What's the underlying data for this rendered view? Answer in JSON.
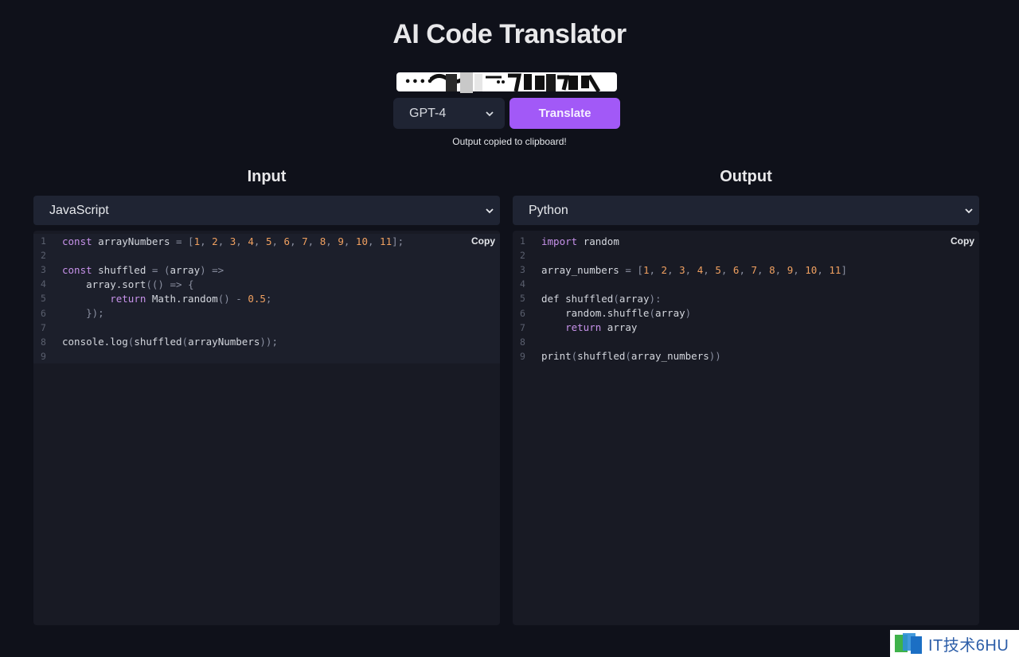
{
  "app": {
    "title": "AI Code Translator"
  },
  "api_key": {
    "value": "••••"
  },
  "model_select": {
    "selected": "GPT-4"
  },
  "translate_button": {
    "label": "Translate"
  },
  "status": {
    "message": "Output copied to clipboard!"
  },
  "input_panel": {
    "heading": "Input",
    "language": "JavaScript",
    "copy_label": "Copy",
    "lines": [
      [
        [
          "const ",
          "kw"
        ],
        [
          "arrayNumbers ",
          "id"
        ],
        [
          "= [",
          "op"
        ],
        [
          "1",
          "num"
        ],
        [
          ", ",
          "op"
        ],
        [
          "2",
          "num"
        ],
        [
          ", ",
          "op"
        ],
        [
          "3",
          "num"
        ],
        [
          ", ",
          "op"
        ],
        [
          "4",
          "num"
        ],
        [
          ", ",
          "op"
        ],
        [
          "5",
          "num"
        ],
        [
          ", ",
          "op"
        ],
        [
          "6",
          "num"
        ],
        [
          ", ",
          "op"
        ],
        [
          "7",
          "num"
        ],
        [
          ", ",
          "op"
        ],
        [
          "8",
          "num"
        ],
        [
          ", ",
          "op"
        ],
        [
          "9",
          "num"
        ],
        [
          ", ",
          "op"
        ],
        [
          "10",
          "num"
        ],
        [
          ", ",
          "op"
        ],
        [
          "11",
          "num"
        ],
        [
          "];",
          "op"
        ]
      ],
      [],
      [
        [
          "const ",
          "kw"
        ],
        [
          "shuffled ",
          "id"
        ],
        [
          "= (",
          "op"
        ],
        [
          "array",
          "id"
        ],
        [
          ") =>",
          "op"
        ]
      ],
      [
        [
          "    array.sort",
          "id"
        ],
        [
          "(() => {",
          "op"
        ]
      ],
      [
        [
          "        ",
          "id"
        ],
        [
          "return ",
          "kw"
        ],
        [
          "Math.random",
          "id"
        ],
        [
          "() - ",
          "op"
        ],
        [
          "0.5",
          "num"
        ],
        [
          ";",
          "op"
        ]
      ],
      [
        [
          "    });",
          "op"
        ]
      ],
      [],
      [
        [
          "console.log",
          "id"
        ],
        [
          "(",
          "op"
        ],
        [
          "shuffled",
          "id"
        ],
        [
          "(",
          "op"
        ],
        [
          "arrayNumbers",
          "id"
        ],
        [
          "));",
          "op"
        ]
      ],
      []
    ]
  },
  "output_panel": {
    "heading": "Output",
    "language": "Python",
    "copy_label": "Copy",
    "lines": [
      [
        [
          "import ",
          "kw"
        ],
        [
          "random",
          "id"
        ]
      ],
      [],
      [
        [
          "array_numbers ",
          "id"
        ],
        [
          "= [",
          "op"
        ],
        [
          "1",
          "num"
        ],
        [
          ", ",
          "op"
        ],
        [
          "2",
          "num"
        ],
        [
          ", ",
          "op"
        ],
        [
          "3",
          "num"
        ],
        [
          ", ",
          "op"
        ],
        [
          "4",
          "num"
        ],
        [
          ", ",
          "op"
        ],
        [
          "5",
          "num"
        ],
        [
          ", ",
          "op"
        ],
        [
          "6",
          "num"
        ],
        [
          ", ",
          "op"
        ],
        [
          "7",
          "num"
        ],
        [
          ", ",
          "op"
        ],
        [
          "8",
          "num"
        ],
        [
          ", ",
          "op"
        ],
        [
          "9",
          "num"
        ],
        [
          ", ",
          "op"
        ],
        [
          "10",
          "num"
        ],
        [
          ", ",
          "op"
        ],
        [
          "11",
          "num"
        ],
        [
          "]",
          "op"
        ]
      ],
      [],
      [
        [
          "def ",
          "id"
        ],
        [
          "shuffled",
          "id"
        ],
        [
          "(",
          "op"
        ],
        [
          "array",
          "id"
        ],
        [
          "):",
          "op"
        ]
      ],
      [
        [
          "    random.shuffle",
          "id"
        ],
        [
          "(",
          "op"
        ],
        [
          "array",
          "id"
        ],
        [
          ")",
          "op"
        ]
      ],
      [
        [
          "    ",
          "id"
        ],
        [
          "return ",
          "kw"
        ],
        [
          "array",
          "id"
        ]
      ],
      [],
      [
        [
          "print",
          "id"
        ],
        [
          "(",
          "op"
        ],
        [
          "shuffled",
          "id"
        ],
        [
          "(",
          "op"
        ],
        [
          "array_numbers",
          "id"
        ],
        [
          "))",
          "op"
        ]
      ]
    ]
  },
  "watermark": {
    "text": "IT技术6HU"
  },
  "colors": {
    "accent": "#a259f7",
    "background": "#0f111a",
    "panel": "#181a24",
    "select": "#1f2433"
  }
}
